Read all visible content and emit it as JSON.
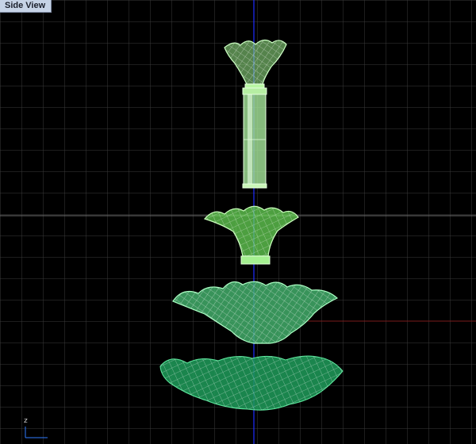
{
  "viewport": {
    "title": "Side View",
    "axis_label": "z"
  },
  "scene": {
    "objects": [
      {
        "name": "tulip-cup-top",
        "color": "#b8f7a2"
      },
      {
        "name": "cylinder-stem",
        "color": "#c9f6b7"
      },
      {
        "name": "tulip-cup-middle",
        "color": "#86f06a"
      },
      {
        "name": "flared-bowl",
        "color": "#62cf82"
      },
      {
        "name": "bottom-bowl",
        "color": "#2fb66f"
      }
    ]
  },
  "colors": {
    "background": "#000000",
    "grid": "#3a3a3a",
    "grid_major": "#777777",
    "axis_vertical": "#1f2bff",
    "axis_horizontal": "#7a1d1d"
  }
}
